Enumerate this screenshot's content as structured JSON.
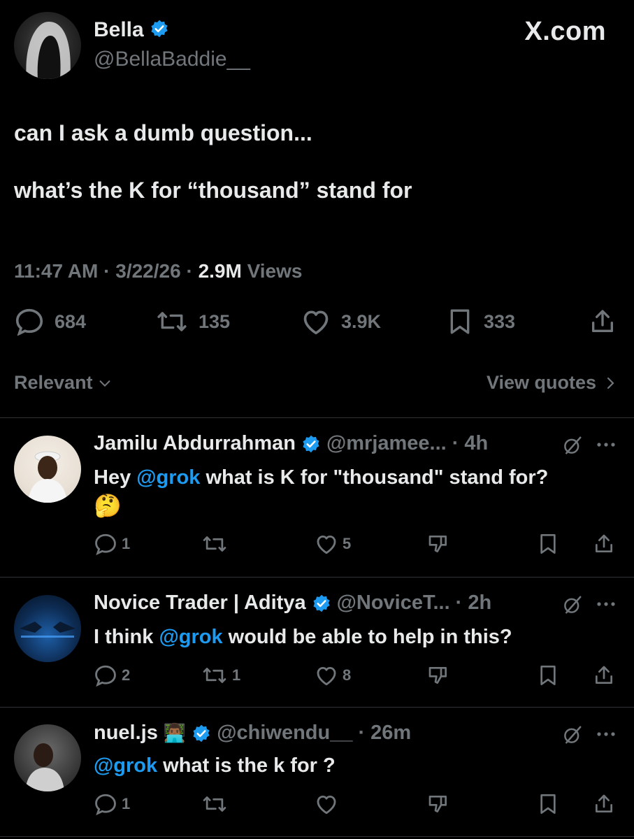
{
  "tweet": {
    "author_name": "Bella",
    "author_handle": "@BellaBaddie__",
    "brand": "X.com",
    "text_line1": "can I ask a dumb question...",
    "text_line2": "what’s the K for “thousand” stand for",
    "time": "11:47 AM",
    "date": "3/22/26",
    "views_count": "2.9M",
    "views_label": "Views",
    "stats": {
      "replies": "684",
      "reposts": "135",
      "likes": "3.9K",
      "bookmarks": "333"
    }
  },
  "sort": {
    "label": "Relevant",
    "view_quotes": "View quotes"
  },
  "replies": [
    {
      "name": "Jamilu Abdurrahman",
      "handle": "@mrjamee...",
      "age": "4h",
      "text_before": "Hey ",
      "mention": "@grok",
      "text_after": " what is K for \"thousand\" stand for?",
      "emoji": "🤔",
      "reply_count": "1",
      "repost_count": "",
      "like_count": "5"
    },
    {
      "name": "Novice Trader | Aditya",
      "handle": "@NoviceT...",
      "age": "2h",
      "text_before": "I think ",
      "mention": "@grok",
      "text_after": " would be able to help in this?",
      "emoji": "",
      "reply_count": "2",
      "repost_count": "1",
      "like_count": "8"
    },
    {
      "name": "nuel.js",
      "name_emoji": "👨🏾‍💻",
      "handle": "@chiwendu__",
      "age": "26m",
      "text_before": "",
      "mention": "@grok",
      "text_after": " what is the k for ?",
      "emoji": "",
      "reply_count": "1",
      "repost_count": "",
      "like_count": ""
    }
  ],
  "colors": {
    "background": "#000000",
    "text": "#e7e9ea",
    "muted": "#71767b",
    "accent": "#1d9bf0",
    "divider": "#2f3336"
  }
}
